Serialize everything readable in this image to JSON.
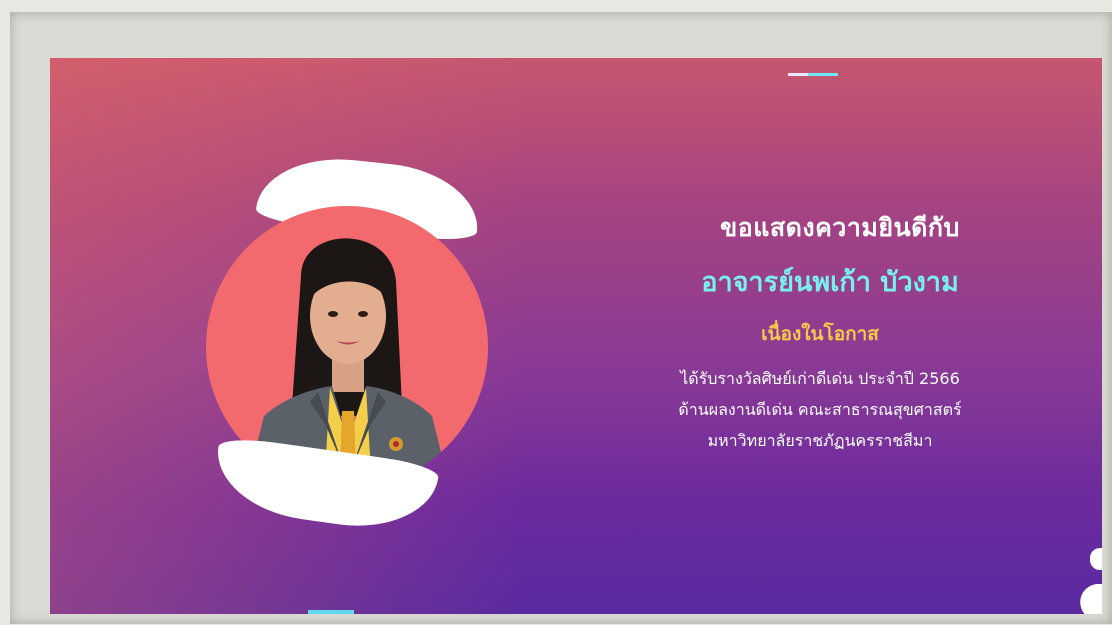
{
  "banner": {
    "greeting": "ขอแสดงความยินดีกับ",
    "name": "อาจารย์นพเก้า บัวงาม",
    "occasion": "เนื่องในโอกาส",
    "details": [
      "ได้รับรางวัลศิษย์เก่าดีเด่น ประจำปี 2566",
      "ด้านผลงานดีเด่น คณะสาธารณสุขศาสตร์",
      "มหาวิทยาลัยราชภัฏนครราชสีมา"
    ]
  },
  "colors": {
    "greeting": "#ffffff",
    "name": "#78f0ee",
    "occasion": "#f7c64a",
    "circle": "#f26a6e",
    "gradient_top": "#c65670",
    "gradient_bottom": "#5a2aa0"
  },
  "icons": {
    "portrait": "person-portrait",
    "decor_arcs": "white-arc-shape"
  }
}
